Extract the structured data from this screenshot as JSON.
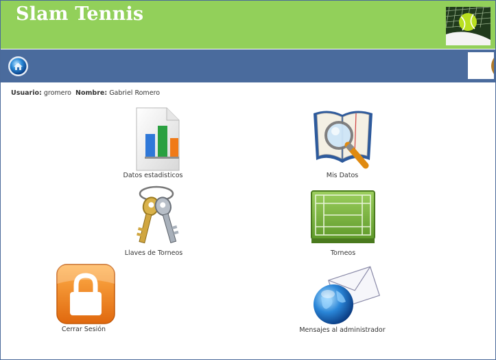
{
  "header": {
    "title": "Slam Tennis"
  },
  "user": {
    "usuario_label": "Usuario:",
    "usuario_value": "gromero",
    "nombre_label": "Nombre:",
    "nombre_value": "Gabriel Romero"
  },
  "menu": {
    "estadisticas": "Datos estadisticos",
    "mis_datos": "Mis Datos",
    "llaves": "Llaves de Torneos",
    "torneos": "Torneos",
    "cerrar": "Cerrar Sesión",
    "mensajes": "Mensajes al administrador"
  },
  "icons": {
    "home": "home-globe-icon",
    "estadisticas": "bar-chart-document-icon",
    "mis_datos": "book-magnifier-icon",
    "llaves": "keys-icon",
    "torneos": "tennis-court-icon",
    "cerrar": "padlock-icon",
    "mensajes": "globe-envelope-icon"
  },
  "colors": {
    "header_bg": "#92d05a",
    "navbar_bg": "#4a6b9d",
    "title_color": "#ffffff"
  }
}
